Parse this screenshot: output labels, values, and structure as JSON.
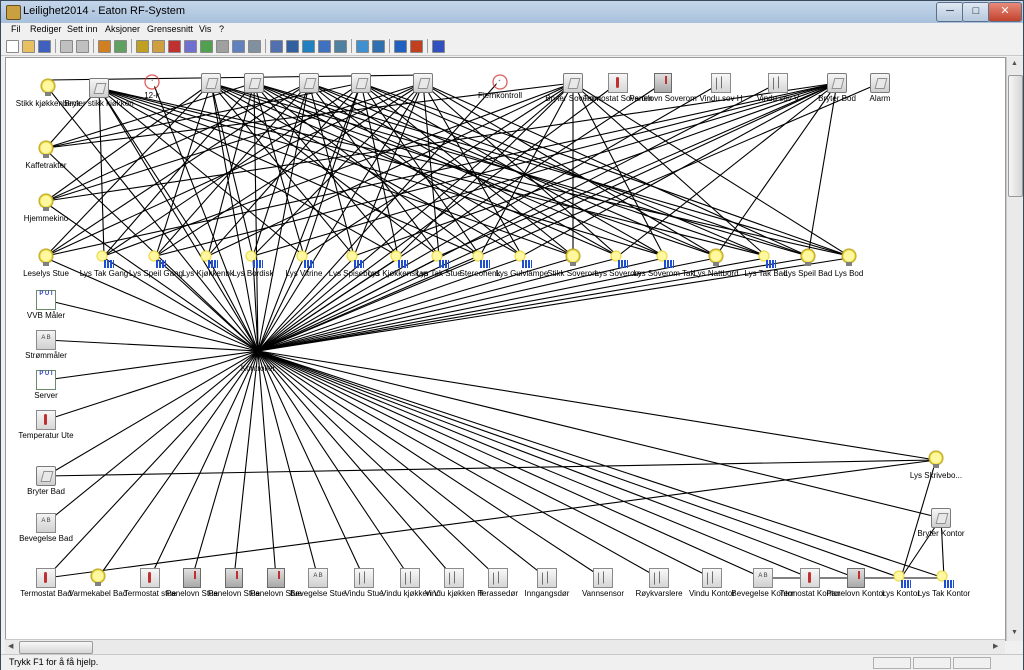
{
  "window": {
    "title": "Leilighet2014 - Eaton RF-System",
    "min_glyph": "─",
    "max_glyph": "□",
    "close_glyph": "✕"
  },
  "menu": [
    "Fil",
    "Rediger",
    "Sett inn",
    "Aksjoner",
    "Grensesnitt",
    "Vis",
    "?"
  ],
  "toolbar_icons": [
    "new-icon",
    "open-icon",
    "save-icon",
    "undo-icon",
    "redo-icon",
    "edit-icon",
    "grid-icon",
    "key-icon",
    "settings-icon",
    "flag-icon",
    "tools-icon",
    "bug-icon",
    "device-icon",
    "list-icon",
    "properties-icon",
    "window-icon",
    "panel-icon",
    "monitor-icon",
    "bars-icon",
    "network-icon",
    "refresh-icon",
    "layers-icon",
    "zoom-in-icon",
    "zoom-out-icon",
    "info-icon"
  ],
  "status": {
    "text": "Trykk F1 for å få hjelp."
  },
  "central": {
    "name": "central",
    "label": "Kontroller"
  },
  "devices": [
    {
      "id": "d1",
      "label": "Stikk kjøkkenbenk",
      "icon": "bulb"
    },
    {
      "id": "d2",
      "label": "Bryter stikk kjøkken",
      "icon": "switch"
    },
    {
      "id": "d3",
      "label": "12-k",
      "icon": "alarm"
    },
    {
      "id": "d4",
      "label": "",
      "icon": "switch"
    },
    {
      "id": "d5",
      "label": "",
      "icon": "switch"
    },
    {
      "id": "d6",
      "label": "",
      "icon": "switch"
    },
    {
      "id": "d7",
      "label": "",
      "icon": "switch"
    },
    {
      "id": "d8",
      "label": "",
      "icon": "switch"
    },
    {
      "id": "d9",
      "label": "Fjernkontroll",
      "icon": "alarm"
    },
    {
      "id": "d10",
      "label": "Bryter Soverom",
      "icon": "switch"
    },
    {
      "id": "d11",
      "label": "Termostat Soverom",
      "icon": "thermo"
    },
    {
      "id": "d12",
      "label": "Panelovn Soverom",
      "icon": "panel"
    },
    {
      "id": "d13",
      "label": "Vindu sov H",
      "icon": "window"
    },
    {
      "id": "d14",
      "label": "Vindu sov V",
      "icon": "window"
    },
    {
      "id": "d15",
      "label": "Bryter Bod",
      "icon": "switch"
    },
    {
      "id": "d16",
      "label": "Alarm",
      "icon": "switch"
    },
    {
      "id": "d17",
      "label": "Kaffetrakter",
      "icon": "bulb"
    },
    {
      "id": "d18",
      "label": "Hjemmekino",
      "icon": "bulb"
    },
    {
      "id": "d19",
      "label": "Leselys Stue",
      "icon": "bulb"
    },
    {
      "id": "d20",
      "label": "Lys Tak Gang",
      "icon": "dimmer"
    },
    {
      "id": "d21",
      "label": "Lys Speil Gang",
      "icon": "dimmer"
    },
    {
      "id": "d22",
      "label": "Lys Kjøkkenbk",
      "icon": "dimmer"
    },
    {
      "id": "d23",
      "label": "Lys Bordisk",
      "icon": "dimmer"
    },
    {
      "id": "d24",
      "label": "Lys Vitrine",
      "icon": "dimmer"
    },
    {
      "id": "d25",
      "label": "Lys Spisebord",
      "icon": "dimmer"
    },
    {
      "id": "d26",
      "label": "Lys Kjøkkenskap",
      "icon": "dimmer"
    },
    {
      "id": "d27",
      "label": "Lys Tak Stue",
      "icon": "dimmer"
    },
    {
      "id": "d28",
      "label": "Stereohenk",
      "icon": "dimmer"
    },
    {
      "id": "d29",
      "label": "Lys Gulvlampe",
      "icon": "dimmer"
    },
    {
      "id": "d30",
      "label": "Stikk Soverom",
      "icon": "bulb"
    },
    {
      "id": "d31",
      "label": "Lys Soverom",
      "icon": "dimmer"
    },
    {
      "id": "d32",
      "label": "Lys Soverom Tak",
      "icon": "dimmer"
    },
    {
      "id": "d33",
      "label": "Lys Nattbord",
      "icon": "bulb"
    },
    {
      "id": "d34",
      "label": "Lys Tak Bad",
      "icon": "dimmer"
    },
    {
      "id": "d35",
      "label": "Lys Speil Bad",
      "icon": "bulb"
    },
    {
      "id": "d36",
      "label": "Lys Bod",
      "icon": "bulb"
    },
    {
      "id": "d37",
      "label": "VVB Måler",
      "icon": "meter"
    },
    {
      "id": "d38",
      "label": "Strømmåler",
      "icon": "sensor"
    },
    {
      "id": "d39",
      "label": "Server",
      "icon": "meter"
    },
    {
      "id": "d40",
      "label": "Temperatur Ute",
      "icon": "thermo"
    },
    {
      "id": "d41",
      "label": "Bryter Bad",
      "icon": "switch"
    },
    {
      "id": "d42",
      "label": "Bevegelse Bad",
      "icon": "sensor"
    },
    {
      "id": "d43",
      "label": "Lys Skrivebo...",
      "icon": "bulb"
    },
    {
      "id": "d44",
      "label": "Bryter Kontor",
      "icon": "switch"
    },
    {
      "id": "d45",
      "label": "Termostat Bad",
      "icon": "thermo"
    },
    {
      "id": "d46",
      "label": "Varmekabel Bad",
      "icon": "bulb"
    },
    {
      "id": "d47",
      "label": "Termostat stue",
      "icon": "thermo"
    },
    {
      "id": "d48",
      "label": "Panelovn Stue",
      "icon": "panel"
    },
    {
      "id": "d49",
      "label": "Panelovn Stue",
      "icon": "panel"
    },
    {
      "id": "d50",
      "label": "Panelovn Stue",
      "icon": "panel"
    },
    {
      "id": "d51",
      "label": "Bevegelse Stue",
      "icon": "sensor"
    },
    {
      "id": "d52",
      "label": "Vindu Stue",
      "icon": "window"
    },
    {
      "id": "d53",
      "label": "Vindu kjøkken V",
      "icon": "window"
    },
    {
      "id": "d54",
      "label": "Vindu kjøkken H",
      "icon": "window"
    },
    {
      "id": "d55",
      "label": "Terassedør",
      "icon": "window"
    },
    {
      "id": "d56",
      "label": "Inngangsdør",
      "icon": "window"
    },
    {
      "id": "d57",
      "label": "Vannsensor",
      "icon": "window"
    },
    {
      "id": "d58",
      "label": "Røykvarslere",
      "icon": "window"
    },
    {
      "id": "d59",
      "label": "Vindu Kontor",
      "icon": "window"
    },
    {
      "id": "d60",
      "label": "Bevegelse Kontor",
      "icon": "sensor"
    },
    {
      "id": "d61",
      "label": "Termostat Kontor",
      "icon": "thermo"
    },
    {
      "id": "d62",
      "label": "Panelovn Kontor",
      "icon": "panel"
    },
    {
      "id": "d63",
      "label": "Lys Kontor",
      "icon": "dimmer"
    },
    {
      "id": "d64",
      "label": "Lys Tak Kontor",
      "icon": "dimmer"
    }
  ]
}
